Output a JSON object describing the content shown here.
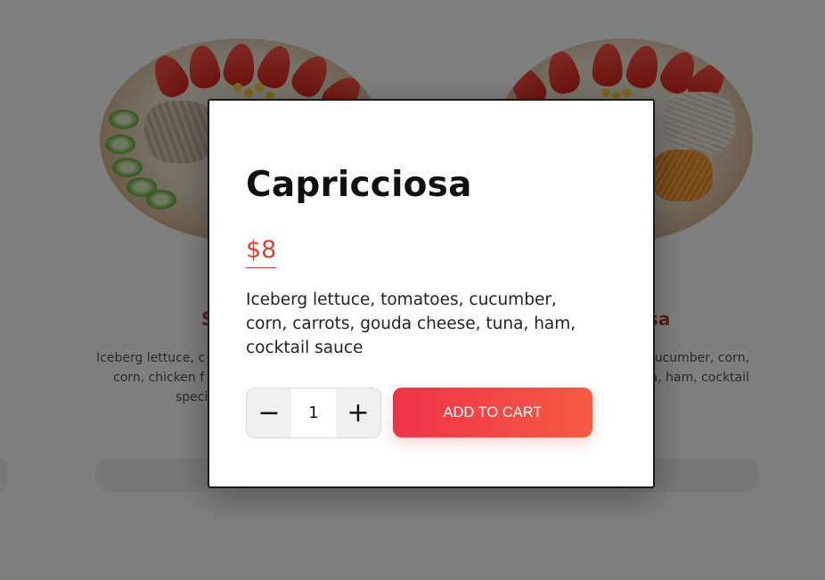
{
  "background": {
    "left_card": {
      "title": "S",
      "description_lines": [
        "Iceberg lettuce, c",
        "corn, chicken f",
        "speci"
      ]
    },
    "right_card": {
      "title": "sa",
      "description_lines": [
        "cucumber, corn,",
        "a, ham, cocktail"
      ]
    }
  },
  "modal": {
    "title": "Capricciosa",
    "price": "$8",
    "description": "Iceberg lettuce, tomatoes, cucumber, corn, carrots, gouda cheese, tuna, ham, cocktail sauce",
    "quantity": {
      "decrement_symbol": "−",
      "value": "1",
      "increment_symbol": "+"
    },
    "add_to_cart_label": "ADD TO CART",
    "accent_color": "#d9412f",
    "button_gradient": [
      "#ef3349",
      "#f55b44"
    ]
  }
}
